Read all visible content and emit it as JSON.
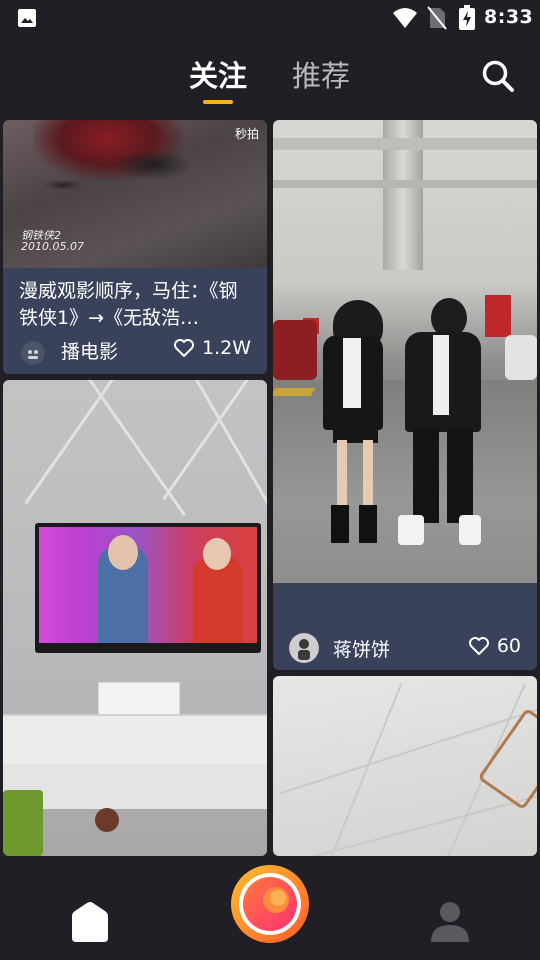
{
  "status_bar": {
    "time": "8:33"
  },
  "tabs": [
    {
      "label": "关注",
      "active": true
    },
    {
      "label": "推荐",
      "active": false
    }
  ],
  "feed": {
    "cards": [
      {
        "watermark": "秒拍",
        "overlay_line1": "钢铁侠2",
        "overlay_line2": "2010.05.07",
        "title": "漫威观影顺序，马住：《钢铁侠1》→《无敌浩…",
        "author": "播电影",
        "likes": "1.2W"
      },
      {
        "author": "蒋饼饼",
        "likes": "60"
      },
      {},
      {}
    ]
  },
  "colors": {
    "accent": "#ffb21a",
    "background": "#1f1f25",
    "card_info": "#39425a",
    "shoot_outer": "#ff8a2b",
    "shoot_inner": "#ff3f6e"
  },
  "icons": [
    "image-icon",
    "wifi-icon",
    "no-sim-icon",
    "battery-charging-icon",
    "search-icon",
    "heart-icon",
    "home-icon",
    "shoot-icon",
    "profile-icon"
  ]
}
